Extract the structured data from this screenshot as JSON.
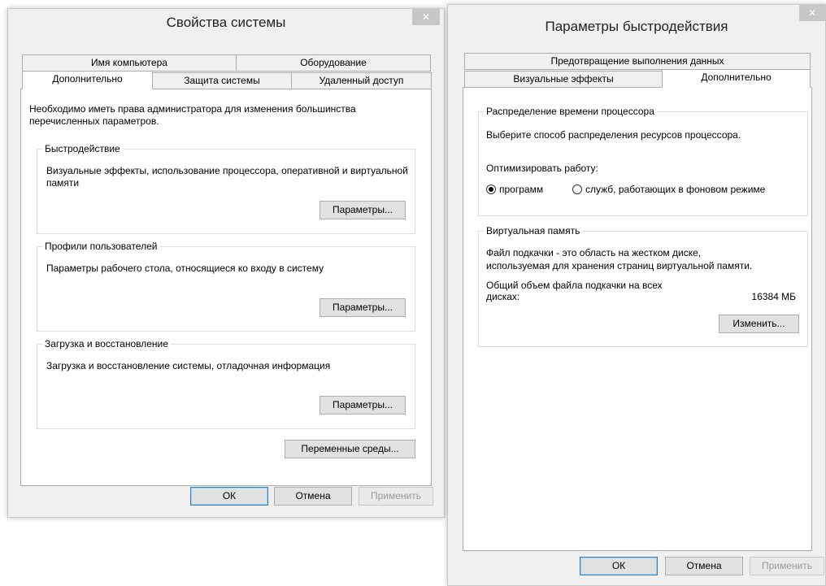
{
  "left_window": {
    "title": "Свойства системы",
    "close_glyph": "✕",
    "tabs_top": [
      "Имя компьютера",
      "Оборудование"
    ],
    "tabs_bottom": [
      "Дополнительно",
      "Защита системы",
      "Удаленный доступ"
    ],
    "active_tab": "Дополнительно",
    "admin_note": "Необходимо иметь права администратора для изменения большинства перечисленных параметров.",
    "groups": [
      {
        "title": "Быстродействие",
        "description": "Визуальные эффекты, использование процессора, оперативной и виртуальной памяти",
        "button": "Параметры..."
      },
      {
        "title": "Профили пользователей",
        "description": "Параметры рабочего стола, относящиеся ко входу в систему",
        "button": "Параметры..."
      },
      {
        "title": "Загрузка и восстановление",
        "description": "Загрузка и восстановление системы, отладочная информация",
        "button": "Параметры..."
      }
    ],
    "env_button": "Переменные среды...",
    "ok": "ОК",
    "cancel": "Отмена",
    "apply": "Применить"
  },
  "right_window": {
    "title": "Параметры быстродействия",
    "close_glyph": "✕",
    "tabs_top": [
      "Предотвращение выполнения данных"
    ],
    "tabs_bottom": [
      "Визуальные эффекты",
      "Дополнительно"
    ],
    "active_tab": "Дополнительно",
    "cpu_group": {
      "title": "Распределение времени процессора",
      "description": "Выберите способ распределения ресурсов процессора.",
      "optimize_label": "Оптимизировать работу:",
      "options": [
        {
          "label": "программ",
          "selected": true
        },
        {
          "label": "служб, работающих в фоновом режиме",
          "selected": false
        }
      ]
    },
    "vm_group": {
      "title": "Виртуальная память",
      "description_line1": "Файл подкачки - это область на жестком диске,",
      "description_line2": "используемая для хранения страниц виртуальной памяти.",
      "total_label_line1": "Общий объем файла подкачки на всех",
      "total_label_line2": "дисках:",
      "total_value": "16384 МБ",
      "change_button": "Изменить..."
    },
    "ok": "ОК",
    "cancel": "Отмена",
    "apply": "Применить"
  },
  "colors": {
    "window_bg": "#f0f0f0",
    "panel_bg": "#ffffff",
    "close_button_bg": "#c7c7c7",
    "default_button_border": "#3c7fb1"
  }
}
